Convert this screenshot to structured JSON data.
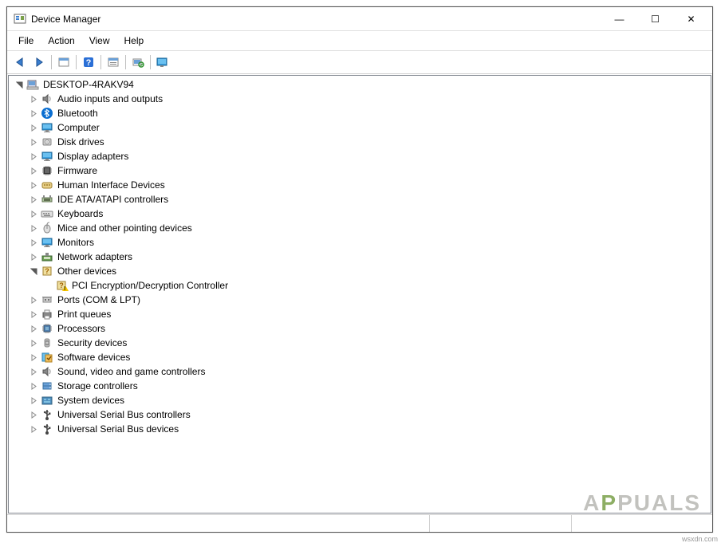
{
  "window": {
    "title": "Device Manager",
    "controls": {
      "minimize": "—",
      "maximize": "☐",
      "close": "✕"
    }
  },
  "menu": {
    "items": [
      "File",
      "Action",
      "View",
      "Help"
    ]
  },
  "toolbar": {
    "buttons": [
      {
        "name": "back",
        "icon": "arrow-left"
      },
      {
        "name": "forward",
        "icon": "arrow-right"
      },
      {
        "name": "sep"
      },
      {
        "name": "show-hidden",
        "icon": "panel"
      },
      {
        "name": "sep"
      },
      {
        "name": "help",
        "icon": "help"
      },
      {
        "name": "sep"
      },
      {
        "name": "properties",
        "icon": "panel2"
      },
      {
        "name": "sep"
      },
      {
        "name": "scan",
        "icon": "scan"
      },
      {
        "name": "sep"
      },
      {
        "name": "update-driver",
        "icon": "monitor-help"
      }
    ]
  },
  "tree": {
    "root": {
      "label": "DESKTOP-4RAKV94",
      "icon": "computer",
      "expanded": true,
      "children": [
        {
          "label": "Audio inputs and outputs",
          "icon": "speaker"
        },
        {
          "label": "Bluetooth",
          "icon": "bluetooth"
        },
        {
          "label": "Computer",
          "icon": "monitor"
        },
        {
          "label": "Disk drives",
          "icon": "disk"
        },
        {
          "label": "Display adapters",
          "icon": "monitor"
        },
        {
          "label": "Firmware",
          "icon": "chip"
        },
        {
          "label": "Human Interface Devices",
          "icon": "hid"
        },
        {
          "label": "IDE ATA/ATAPI controllers",
          "icon": "ide"
        },
        {
          "label": "Keyboards",
          "icon": "keyboard"
        },
        {
          "label": "Mice and other pointing devices",
          "icon": "mouse"
        },
        {
          "label": "Monitors",
          "icon": "monitor"
        },
        {
          "label": "Network adapters",
          "icon": "network"
        },
        {
          "label": "Other devices",
          "icon": "other",
          "expanded": true,
          "children": [
            {
              "label": "PCI Encryption/Decryption Controller",
              "icon": "other",
              "warning": true,
              "leaf": true
            }
          ]
        },
        {
          "label": "Ports (COM & LPT)",
          "icon": "port"
        },
        {
          "label": "Print queues",
          "icon": "printer"
        },
        {
          "label": "Processors",
          "icon": "cpu"
        },
        {
          "label": "Security devices",
          "icon": "security"
        },
        {
          "label": "Software devices",
          "icon": "software"
        },
        {
          "label": "Sound, video and game controllers",
          "icon": "speaker"
        },
        {
          "label": "Storage controllers",
          "icon": "storage"
        },
        {
          "label": "System devices",
          "icon": "system"
        },
        {
          "label": "Universal Serial Bus controllers",
          "icon": "usb"
        },
        {
          "label": "Universal Serial Bus devices",
          "icon": "usb"
        }
      ]
    }
  },
  "watermark": "APPUALS",
  "source": "wsxdn.com"
}
